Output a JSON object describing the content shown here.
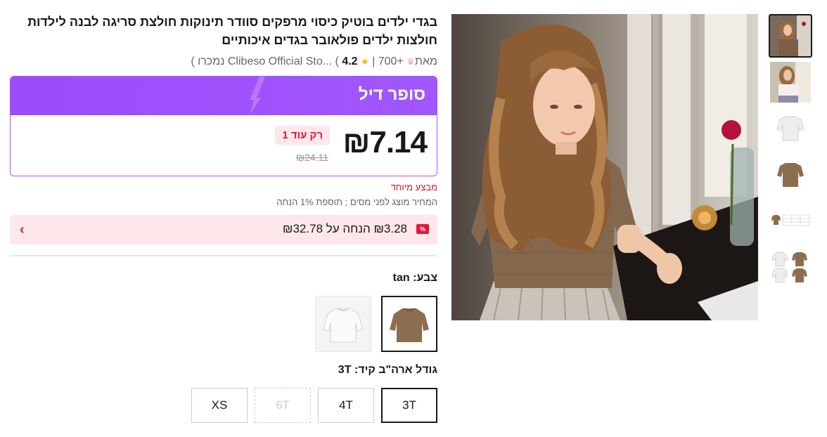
{
  "product": {
    "title": "בגדי ילדים בוטיק כיסוי מרפקים סוודר תינוקות חולצת סריגה לבנה לילדות חולצות ילדים פולאובר בגדים איכותיים",
    "store_prefix": "מאת",
    "store_name": "Clibeso Official Sto...",
    "rating": "4.2",
    "star": "★",
    "sold_count": "700+",
    "sold_label": "נמכרו",
    "rating_sep": "|"
  },
  "deal": {
    "title": "סופר דיל",
    "price": "₪7.14",
    "only_left": "רק עוד 1",
    "old_price": "₪24.11",
    "special_offer": "מבצע מיוחד",
    "tax_note": "המחיר מוצג לפני מסים ; תוספת 1% הנחה"
  },
  "coupon": {
    "badge": "%",
    "text": "₪3.28 הנחה על ₪32.78",
    "chevron": "›"
  },
  "color": {
    "label": "צבע:",
    "value": "tan",
    "options": [
      "tan",
      "white"
    ]
  },
  "size": {
    "label": "גודל ארה\"ב קיד:",
    "value": "3T",
    "options": [
      {
        "label": "3T",
        "state": "selected"
      },
      {
        "label": "4T",
        "state": "normal"
      },
      {
        "label": "6T",
        "state": "disabled"
      },
      {
        "label": "XS",
        "state": "normal"
      }
    ]
  },
  "colors": {
    "deal_purple": "#a057ff",
    "accent_red": "#e1183a",
    "coupon_bg": "#fde7ea",
    "tan": "#8b6d4f"
  }
}
